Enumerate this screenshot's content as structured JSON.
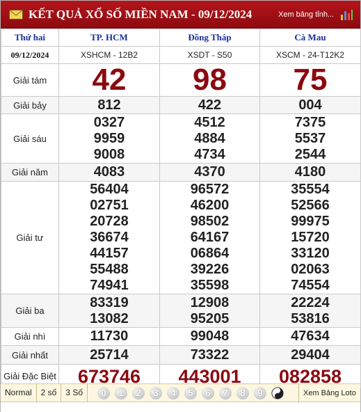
{
  "header": {
    "title": "KẾT QUẢ XỔ SỐ MIỀN NAM - 09/12/2024",
    "link_label": "Xem bảng tỉnh..."
  },
  "table": {
    "day": "Thứ hai",
    "date": "09/12/2024",
    "provinces": [
      {
        "name": "TP. HCM",
        "code": "XSHCM - 12B2"
      },
      {
        "name": "Đồng Tháp",
        "code": "XSDT - S50"
      },
      {
        "name": "Cà Mau",
        "code": "XSCM - 24-T12K2"
      }
    ],
    "prizes": {
      "g8": {
        "label": "Giải tám",
        "values": [
          "42",
          "98",
          "75"
        ]
      },
      "g7": {
        "label": "Giải bảy",
        "values": [
          "812",
          "422",
          "004"
        ]
      },
      "g6": {
        "label": "Giải sáu",
        "values": [
          [
            "0327",
            "9959",
            "9008"
          ],
          [
            "4512",
            "4884",
            "4734"
          ],
          [
            "7375",
            "5537",
            "2544"
          ]
        ]
      },
      "g5": {
        "label": "Giải năm",
        "values": [
          "4083",
          "4370",
          "4180"
        ]
      },
      "g4": {
        "label": "Giải tư",
        "values": [
          [
            "56404",
            "02751",
            "20728",
            "36674",
            "44157",
            "55488",
            "74941"
          ],
          [
            "96572",
            "46200",
            "98502",
            "64167",
            "06864",
            "39226",
            "35598"
          ],
          [
            "35554",
            "52566",
            "99975",
            "15720",
            "33120",
            "02063",
            "74554"
          ]
        ]
      },
      "g3": {
        "label": "Giải ba",
        "values": [
          [
            "83319",
            "13082"
          ],
          [
            "12908",
            "95205"
          ],
          [
            "22224",
            "53816"
          ]
        ]
      },
      "g2": {
        "label": "Giải nhì",
        "values": [
          "11730",
          "99048",
          "47634"
        ]
      },
      "g1": {
        "label": "Giải nhất",
        "values": [
          "25714",
          "73322",
          "29404"
        ]
      },
      "db": {
        "label": "Giải Đặc Biệt",
        "values": [
          "673746",
          "443001",
          "082858"
        ]
      }
    }
  },
  "footer": {
    "tabs": [
      "Normal",
      "2 số",
      "3 Số"
    ],
    "digits": [
      "0",
      "1",
      "2",
      "3",
      "4",
      "5",
      "6",
      "7",
      "8",
      "9"
    ],
    "loto_label": "Xem Bảng Loto"
  },
  "colors": {
    "header_bg": "#a3121a",
    "prize_red": "#8b0a0f",
    "province_blue": "#1a2d9e",
    "footer_bg": "#fdf7e1"
  }
}
